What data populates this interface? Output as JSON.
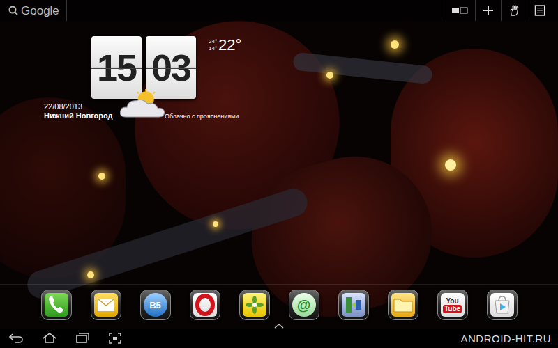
{
  "search": {
    "label": "Google"
  },
  "clock": {
    "hours": "15",
    "minutes": "03"
  },
  "weather": {
    "high": "24°",
    "low": "14°",
    "current": "22°",
    "date": "22/08/2013",
    "city": "Нижний Новгород",
    "condition": "Облачно с прояснениями"
  },
  "dock": [
    {
      "kind": "phone"
    },
    {
      "kind": "mail"
    },
    {
      "kind": "player",
      "texts": [
        "B5"
      ]
    },
    {
      "kind": "opera"
    },
    {
      "kind": "gallery"
    },
    {
      "kind": "email",
      "texts": [
        "@"
      ]
    },
    {
      "kind": "transfer"
    },
    {
      "kind": "files"
    },
    {
      "kind": "youtube",
      "texts": [
        "You",
        "Tube"
      ]
    },
    {
      "kind": "store"
    }
  ],
  "watermark": "ANDROID-HIT.RU"
}
